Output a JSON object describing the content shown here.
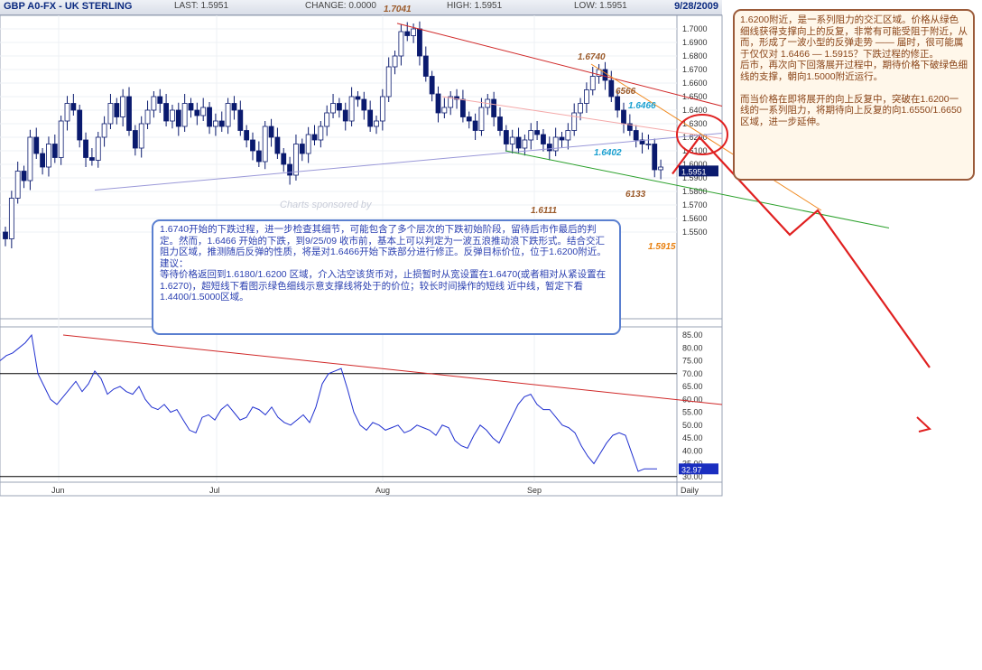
{
  "header": {
    "symbol": "GBP A0-FX - UK STERLING",
    "last": "LAST: 1.5951",
    "change": "CHANGE: 0.0000",
    "high": "HIGH: 1.5951",
    "low": "LOW: 1.5951",
    "date": "9/28/2009"
  },
  "watermark": "Charts sponsored by",
  "colors": {
    "candle_up": "#ffffff",
    "candle_down": "#0a1a6e",
    "resistance_line": "#d02828",
    "pink_line": "#f4a8a8",
    "support_line": "#2aa02a",
    "lavender_line": "#9a98d8",
    "orange_line": "#f08a20",
    "projection": "#e02020",
    "indicator_line": "#2030d0",
    "annotation_brown": "#9b5a2a",
    "annotation_blue": "#1aa0d0",
    "annotation_orange": "#e88010"
  },
  "chart_data": [
    {
      "type": "candlestick",
      "title": "GBP A0-FX - UK STERLING",
      "ylim": [
        1.535,
        1.71
      ],
      "y_ticks": [
        "1.7000",
        "1.6900",
        "1.6800",
        "1.6700",
        "1.6600",
        "1.6500",
        "1.6400",
        "1.6300",
        "1.6200",
        "1.6100",
        "1.6000",
        "1.5900",
        "1.5800",
        "1.5700",
        "1.5600",
        "1.5500"
      ],
      "x_ticks": [
        "Jun",
        "Jul",
        "Aug",
        "Sep",
        "Daily"
      ],
      "last_price_label": "1.5951",
      "closes": [
        1.545,
        1.575,
        1.595,
        1.588,
        1.62,
        1.608,
        1.598,
        1.615,
        1.605,
        1.632,
        1.645,
        1.64,
        1.618,
        1.605,
        1.603,
        1.62,
        1.63,
        1.645,
        1.635,
        1.65,
        1.625,
        1.612,
        1.63,
        1.64,
        1.65,
        1.645,
        1.632,
        1.64,
        1.628,
        1.645,
        1.64,
        1.636,
        1.642,
        1.628,
        1.632,
        1.628,
        1.645,
        1.64,
        1.625,
        1.618,
        1.61,
        1.602,
        1.628,
        1.62,
        1.608,
        1.6,
        1.592,
        1.615,
        1.608,
        1.622,
        1.618,
        1.628,
        1.638,
        1.645,
        1.64,
        1.632,
        1.65,
        1.648,
        1.64,
        1.628,
        1.632,
        1.65,
        1.672,
        1.68,
        1.698,
        1.695,
        1.7,
        1.68,
        1.665,
        1.652,
        1.638,
        1.642,
        1.65,
        1.648,
        1.635,
        1.632,
        1.625,
        1.642,
        1.648,
        1.635,
        1.625,
        1.615,
        1.62,
        1.612,
        1.618,
        1.625,
        1.622,
        1.615,
        1.61,
        1.62,
        1.618,
        1.625,
        1.638,
        1.645,
        1.655,
        1.665,
        1.67,
        1.662,
        1.65,
        1.64,
        1.63,
        1.625,
        1.618,
        1.615,
        1.615,
        1.596,
        1.598
      ],
      "annotations": [
        "1.7041",
        "1.6740",
        "6566",
        "1.6466",
        "1.6402",
        "6133",
        "1.6111",
        "1.5915"
      ]
    },
    {
      "type": "line",
      "ylim": [
        30,
        85
      ],
      "y_ticks": [
        "85.00",
        "80.00",
        "75.00",
        "70.00",
        "65.00",
        "60.00",
        "55.00",
        "50.00",
        "45.00",
        "40.00",
        "35.00",
        "30.00"
      ],
      "current_value_label": "32.97",
      "values": [
        75,
        77,
        78,
        80,
        82,
        85,
        70,
        65,
        60,
        58,
        61,
        64,
        67,
        63,
        66,
        71,
        68,
        62,
        64,
        65,
        63,
        62,
        65,
        60,
        57,
        56,
        58,
        55,
        56,
        52,
        48,
        47,
        53,
        54,
        52,
        56,
        58,
        55,
        52,
        53,
        57,
        56,
        54,
        57,
        53,
        51,
        50,
        52,
        54,
        51,
        57,
        66,
        70,
        71,
        72,
        64,
        55,
        50,
        48,
        51,
        50,
        48,
        49,
        50,
        47,
        48,
        50,
        49,
        48,
        46,
        50,
        49,
        44,
        42,
        41,
        46,
        50,
        48,
        45,
        43,
        48,
        53,
        58,
        61,
        62,
        58,
        56,
        56,
        53,
        50,
        49,
        47,
        42,
        38,
        35,
        39,
        43,
        46,
        47,
        46,
        39,
        32,
        33,
        33,
        32.97
      ]
    }
  ],
  "notes": {
    "blue": "1.6740开始的下跌过程，进一步检查其细节，可能包含了多个层次的下跌初始阶段，留待后市作最后的判定。然而，1.6466 开始的下跌，到9/25/09 收市前，基本上可以判定为一波五浪推动浪下跌形式。结合交汇阻力区域，推测随后反弹的性质，将是对1.6466开始下跌部分进行修正。反弹目标价位，位于1.6200附近。\n建议：\n等待价格返回到1.6180/1.6200 区域，介入沽空该货币对，止损暂时从宽设置在1.6470(或者相对从紧设置在1.6270)，超短线下看图示绿色细线示意支撑线将处于的价位；较长时间操作的短线 近中线，暂定下看1.4400/1.5000区域。",
    "brown": "1.6200附近，是一系列阻力的交汇区域。价格从绿色细线获得支撑向上的反复，非常有可能受阻于附近，从而，形成了一波小型的反弹走势 —— 届时，很可能属于仅仅对 1.6466 — 1.5915？下跌过程的修正。\n后市，再次向下回落展开过程中，期待价格下破绿色细线的支撑，朝向1.5000附近运行。\n\n而当价格在即将展开的向上反复中，突破在1.6200一线的一系列阻力，将期待向上反复的向1.6550/1.6650区域，进一步延伸。"
  }
}
